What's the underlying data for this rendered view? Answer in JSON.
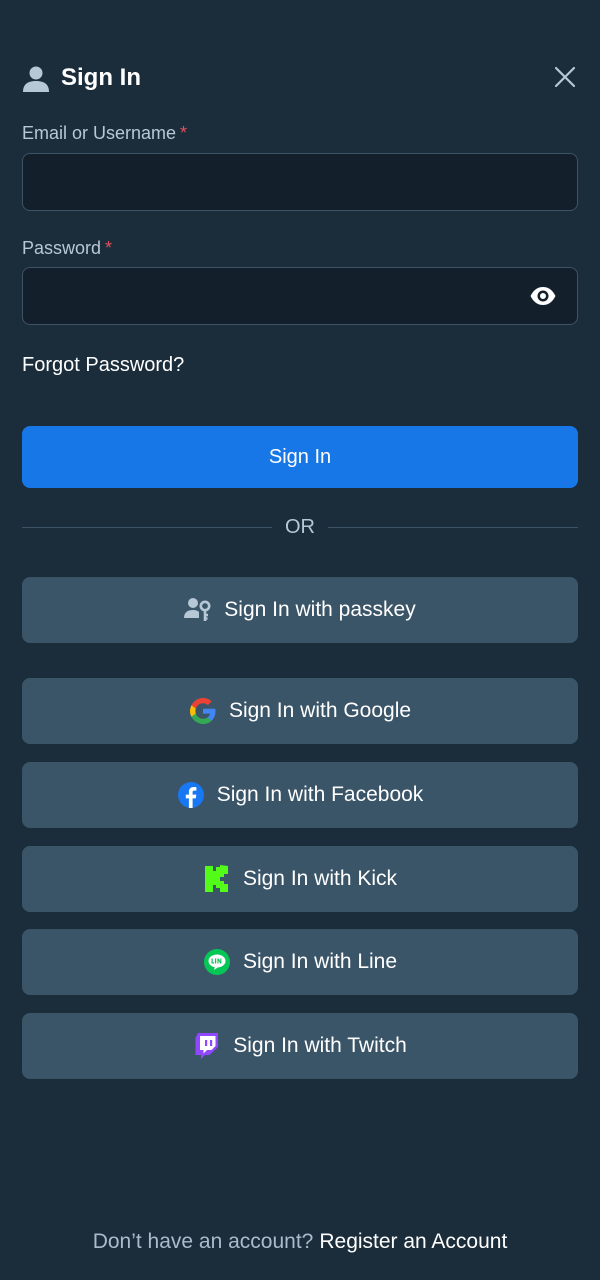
{
  "header": {
    "title": "Sign In",
    "user_icon": "user-icon",
    "close_icon": "close-icon"
  },
  "form": {
    "email": {
      "label": "Email or Username",
      "required_mark": "*",
      "value": "",
      "placeholder": ""
    },
    "password": {
      "label": "Password",
      "required_mark": "*",
      "value": "",
      "placeholder": "",
      "toggle_icon": "eye-icon"
    },
    "forgot_label": "Forgot Password?",
    "submit_label": "Sign In"
  },
  "divider_label": "OR",
  "social": {
    "passkey": "Sign In with passkey",
    "google": "Sign In with Google",
    "facebook": "Sign In with Facebook",
    "kick": "Sign In with Kick",
    "line": "Sign In with Line",
    "twitch": "Sign In with Twitch"
  },
  "footer": {
    "prompt": "Don’t have an account?",
    "link": "Register an Account"
  },
  "colors": {
    "background": "#1b2c3a",
    "input_bg": "#131f2a",
    "primary": "#1877e6",
    "social_bg": "#3b5568",
    "required": "#e2505a"
  }
}
